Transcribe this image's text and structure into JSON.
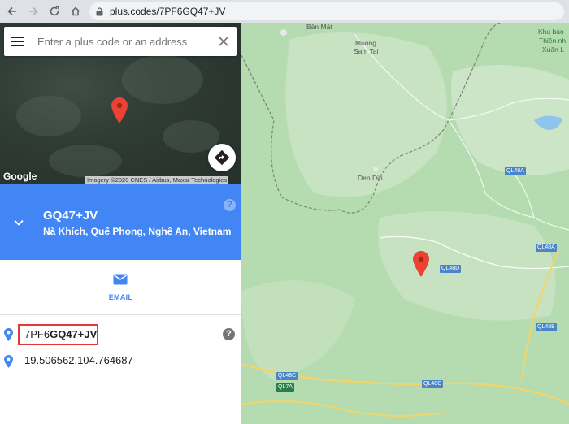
{
  "browser": {
    "url": "plus.codes/7PF6GQ47+JV"
  },
  "search": {
    "placeholder": "Enter a plus code or an address"
  },
  "imagery": {
    "google_logo": "Google",
    "attribution": "Imagery ©2020 CNES / Airbus, Maxar Technologies"
  },
  "place": {
    "code_short": "GQ47+JV",
    "address": "Nà Khích, Quế Phong, Nghệ An, Vietnam",
    "code_prefix": "7PF6",
    "code_suffix": "GQ47+JV",
    "coordinates": "19.506562,104.764687"
  },
  "actions": {
    "email_label": "EMAIL"
  },
  "map": {
    "labels": {
      "ban_mat": "Bản Mát",
      "muong": "Muong",
      "sam_tai": "Sam Tai",
      "den_din": "Den Din",
      "khu_bao_1": "Khu bảo",
      "khu_bao_2": "Thiên nh",
      "khu_bao_3": "Xuân L"
    },
    "roads": {
      "ql48a_1": "QL48A",
      "ql48a_2": "QL48A",
      "ql48d": "QL48D",
      "ql48b": "QL48B",
      "ql48c_1": "QL48C",
      "ql7a": "QL7A",
      "ql48c_2": "QL48C"
    }
  },
  "colors": {
    "accent": "#4285f4",
    "pin": "#ea4335",
    "highlight_border": "#e53935"
  }
}
